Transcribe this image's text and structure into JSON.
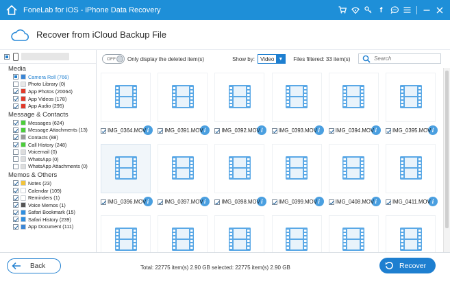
{
  "app": {
    "title": "FoneLab for iOS - iPhone Data Recovery",
    "accent_color": "#1e8fd8",
    "titlebar_icons": [
      "cart-icon",
      "wifi-icon",
      "key-icon",
      "facebook-icon",
      "chat-icon",
      "menu-icon",
      "minimize-icon",
      "close-icon"
    ]
  },
  "header": {
    "title": "Recover from iCloud Backup File"
  },
  "sidebar": {
    "sections": [
      {
        "title": "Media",
        "items": [
          {
            "label": "Camera Roll (766)",
            "checked": "partial",
            "icon": "camera-roll-icon",
            "color": "#3b86d6",
            "active": true
          },
          {
            "label": "Photo Library (0)",
            "checked": "off",
            "icon": "photo-library-icon",
            "color": "#e8e8e8",
            "active": false
          },
          {
            "label": "App Photos (20064)",
            "checked": "on",
            "icon": "app-photos-icon",
            "color": "#e23a2a",
            "active": false
          },
          {
            "label": "App Videos (178)",
            "checked": "on",
            "icon": "app-videos-icon",
            "color": "#e23a2a",
            "active": false
          },
          {
            "label": "App Audio (295)",
            "checked": "on",
            "icon": "app-audio-icon",
            "color": "#e23a2a",
            "active": false
          }
        ]
      },
      {
        "title": "Message & Contacts",
        "items": [
          {
            "label": "Messages (624)",
            "checked": "on",
            "icon": "messages-icon",
            "color": "#4ccd3a",
            "active": false
          },
          {
            "label": "Message Attachments (13)",
            "checked": "on",
            "icon": "attachments-icon",
            "color": "#4ccd3a",
            "active": false
          },
          {
            "label": "Contacts (88)",
            "checked": "on",
            "icon": "contacts-icon",
            "color": "#9a9a9a",
            "active": false
          },
          {
            "label": "Call History (248)",
            "checked": "on",
            "icon": "phone-icon",
            "color": "#4ccd3a",
            "active": false
          },
          {
            "label": "Voicemail (0)",
            "checked": "off",
            "icon": "voicemail-icon",
            "color": "#dddddd",
            "active": false
          },
          {
            "label": "WhatsApp (0)",
            "checked": "off",
            "icon": "whatsapp-icon",
            "color": "#dddddd",
            "active": false
          },
          {
            "label": "WhatsApp Attachments (0)",
            "checked": "off",
            "icon": "whatsapp-attachments-icon",
            "color": "#dddddd",
            "active": false
          }
        ]
      },
      {
        "title": "Memos & Others",
        "items": [
          {
            "label": "Notes (23)",
            "checked": "on",
            "icon": "notes-icon",
            "color": "#f2c33a",
            "active": false
          },
          {
            "label": "Calendar (109)",
            "checked": "on",
            "icon": "calendar-icon",
            "color": "#ffffff",
            "active": false
          },
          {
            "label": "Reminders (1)",
            "checked": "on",
            "icon": "reminders-icon",
            "color": "#ffffff",
            "active": false
          },
          {
            "label": "Voice Memos (1)",
            "checked": "on",
            "icon": "voice-memos-icon",
            "color": "#555555",
            "active": false
          },
          {
            "label": "Safari Bookmark (15)",
            "checked": "on",
            "icon": "safari-bookmark-icon",
            "color": "#2f8fe0",
            "active": false
          },
          {
            "label": "Safari History (239)",
            "checked": "on",
            "icon": "safari-history-icon",
            "color": "#2f8fe0",
            "active": false
          },
          {
            "label": "App Document (111)",
            "checked": "on",
            "icon": "app-document-icon",
            "color": "#3b86d6",
            "active": false
          }
        ]
      }
    ]
  },
  "toolbar": {
    "toggle_label": "OFF",
    "only_deleted_label": "Only display the deleted item(s)",
    "show_by_label": "Show by:",
    "show_by_value": "Video",
    "files_filtered": "Files filtered: 33 item(s)",
    "search_placeholder": "Search"
  },
  "grid": {
    "files": [
      {
        "name": "IMG_0364.MOV",
        "selected": false
      },
      {
        "name": "IMG_0391.MOV",
        "selected": false
      },
      {
        "name": "IMG_0392.MOV",
        "selected": false
      },
      {
        "name": "IMG_0393.MOV",
        "selected": false
      },
      {
        "name": "IMG_0394.MOV",
        "selected": false
      },
      {
        "name": "IMG_0395.MOV",
        "selected": false
      },
      {
        "name": "IMG_0396.MOV",
        "selected": true
      },
      {
        "name": "IMG_0397.MOV",
        "selected": false
      },
      {
        "name": "IMG_0398.MOV",
        "selected": false
      },
      {
        "name": "IMG_0399.MOV",
        "selected": false
      },
      {
        "name": "IMG_0408.MOV",
        "selected": false
      },
      {
        "name": "IMG_0411.MOV",
        "selected": false
      },
      {
        "name": "",
        "selected": false
      },
      {
        "name": "",
        "selected": false
      },
      {
        "name": "",
        "selected": false
      },
      {
        "name": "",
        "selected": false
      },
      {
        "name": "",
        "selected": false
      },
      {
        "name": "",
        "selected": false
      }
    ]
  },
  "footer": {
    "back_label": "Back",
    "totals": "Total: 22775 item(s) 2.90 GB   selected: 22775 item(s) 2.90 GB",
    "recover_label": "Recover"
  }
}
